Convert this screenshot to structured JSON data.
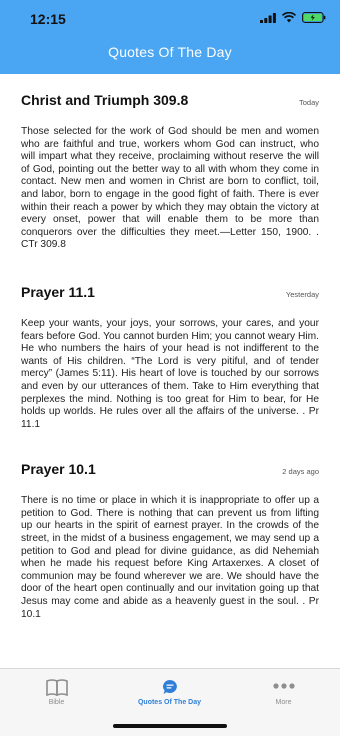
{
  "status_bar": {
    "time": "12:15"
  },
  "header": {
    "title": "Quotes Of The Day"
  },
  "colors": {
    "header": "#4aa6f2",
    "accent": "#2f7fd8",
    "battery": "#4cd964"
  },
  "quotes": [
    {
      "title": "Christ and Triumph 309.8",
      "date": "Today",
      "text": "Those selected for the work of God should be men and women who are faithful and true, workers whom God can instruct, who will impart what they receive, proclaiming without reserve the will of God, pointing out the better way to all with whom they come in contact. New men and women in Christ are born to conflict, toil, and labor, born to engage in the good fight of faith. There is ever within their reach a power by which they may obtain the victory at every onset, power that will enable them to be more than conquerors over the difficulties they meet.—Letter 150, 1900. . CTr 309.8"
    },
    {
      "title": "Prayer 11.1",
      "date": "Yesterday",
      "text": "Keep your wants, your joys, your sorrows, your cares, and your fears before God. You cannot burden Him; you cannot weary Him. He who numbers the hairs of your head is not indifferent to the wants of His children. “The Lord is very pitiful, and of tender mercy” (James 5:11). His heart of love is touched by our sorrows and even by our utterances of them. Take to Him everything that perplexes the mind. Nothing is too great for Him to bear, for He holds up worlds. He rules over all the affairs of the universe. . Pr 11.1"
    },
    {
      "title": "Prayer 10.1",
      "date": "2 days ago",
      "text": "There is no time or place in which it is inappropriate to offer up a petition to God. There is nothing that can prevent us from lifting up our hearts in the spirit of earnest prayer. In the crowds of the street, in the midst of a business engagement, we may send up a petition to God and plead for divine guidance, as did Nehemiah when he made his request before King Artaxerxes. A closet of communion may be found wherever we are. We should have the door of the heart open continually and our invitation going up that Jesus may come and abide as a heavenly guest in the soul. . Pr 10.1"
    }
  ],
  "tabbar": {
    "tabs": [
      {
        "label": "Bible",
        "icon": "book-icon"
      },
      {
        "label": "Quotes Of The Day",
        "icon": "chat-bubble-icon",
        "active": true
      },
      {
        "label": "More",
        "icon": "more-dots-icon"
      }
    ]
  }
}
